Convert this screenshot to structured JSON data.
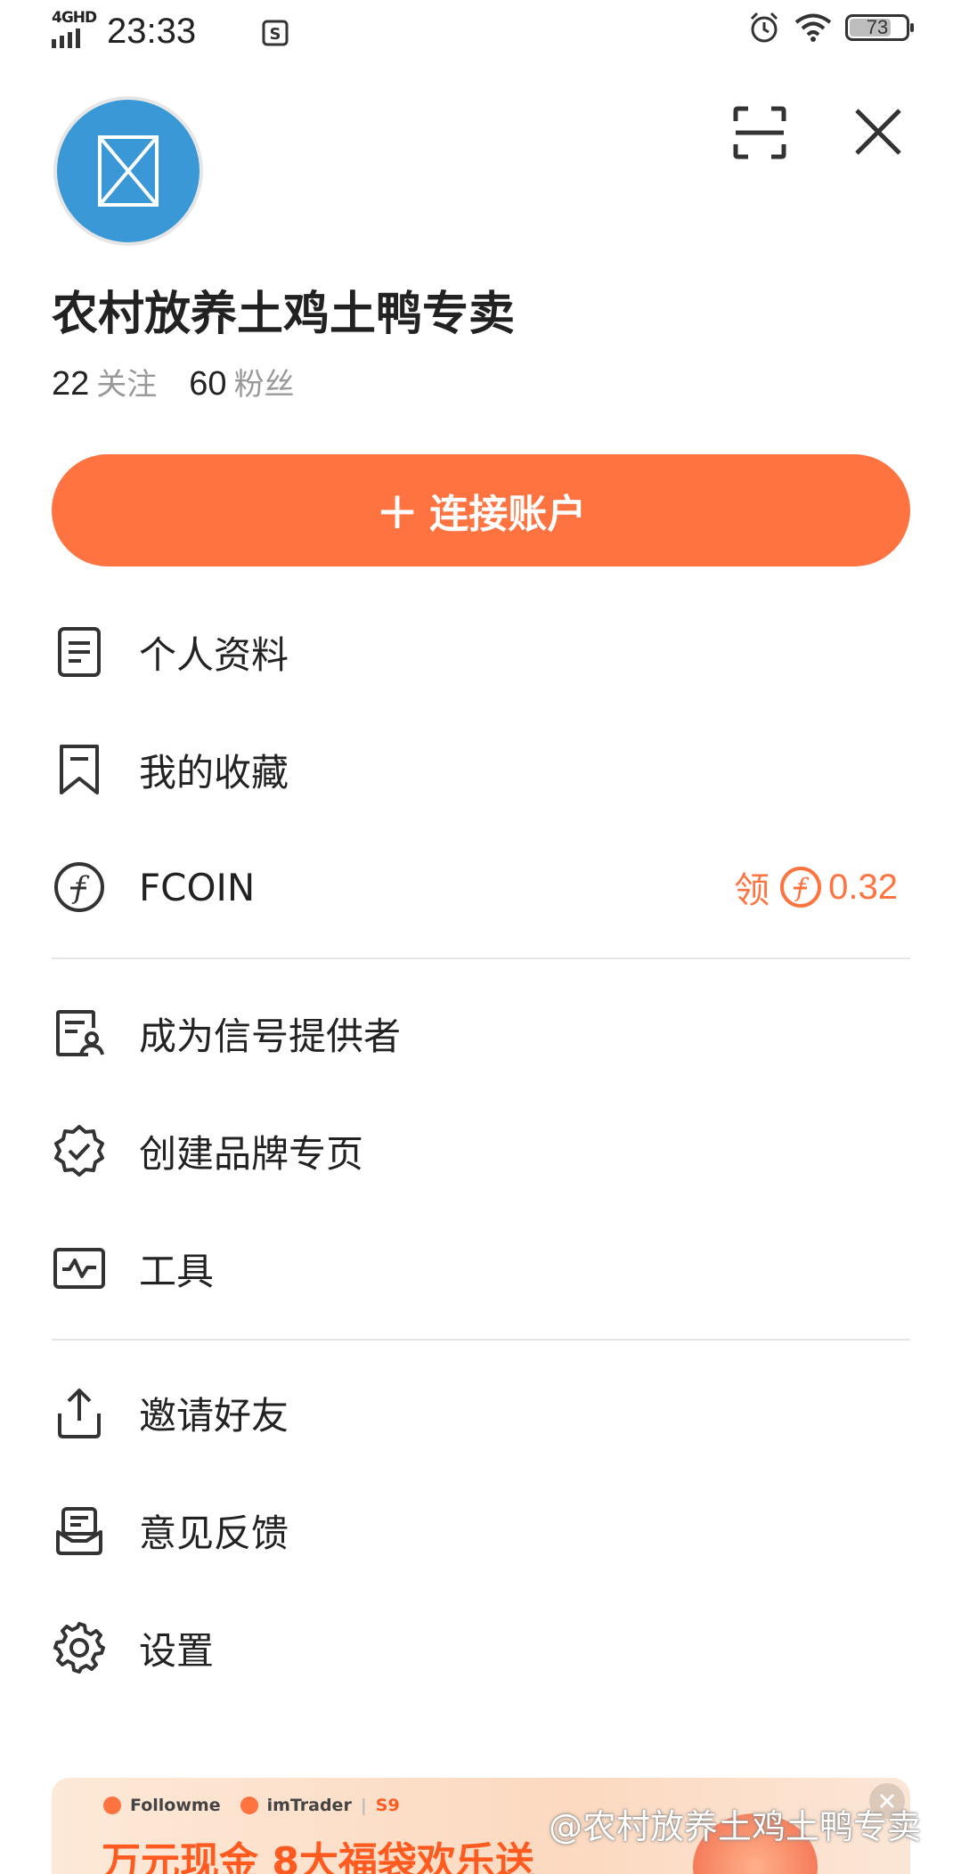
{
  "status_bar": {
    "network": "4GHD",
    "time": "23:33",
    "battery": "73"
  },
  "profile": {
    "name": "农村放养土鸡土鸭专卖",
    "following_count": "22",
    "following_label": "关注",
    "followers_count": "60",
    "followers_label": "粉丝"
  },
  "connect_button": {
    "plus": "+",
    "label": "连接账户"
  },
  "menu": {
    "profile_info": "个人资料",
    "favorites": "我的收藏",
    "fcoin": "FCOIN",
    "fcoin_claim": "领",
    "fcoin_amount": "0.32",
    "signal_provider": "成为信号提供者",
    "brand_page": "创建品牌专页",
    "tools": "工具",
    "invite": "邀请好友",
    "feedback": "意见反馈",
    "settings": "设置"
  },
  "banner": {
    "brand1": "Followme",
    "brand2": "imTrader",
    "brand3": "S9",
    "headline": "万元现金 8大福袋欢乐送"
  },
  "watermark": "@农村放养土鸡土鸭专卖",
  "colors": {
    "accent": "#ff7341",
    "avatar_bg": "#3a98d6"
  }
}
